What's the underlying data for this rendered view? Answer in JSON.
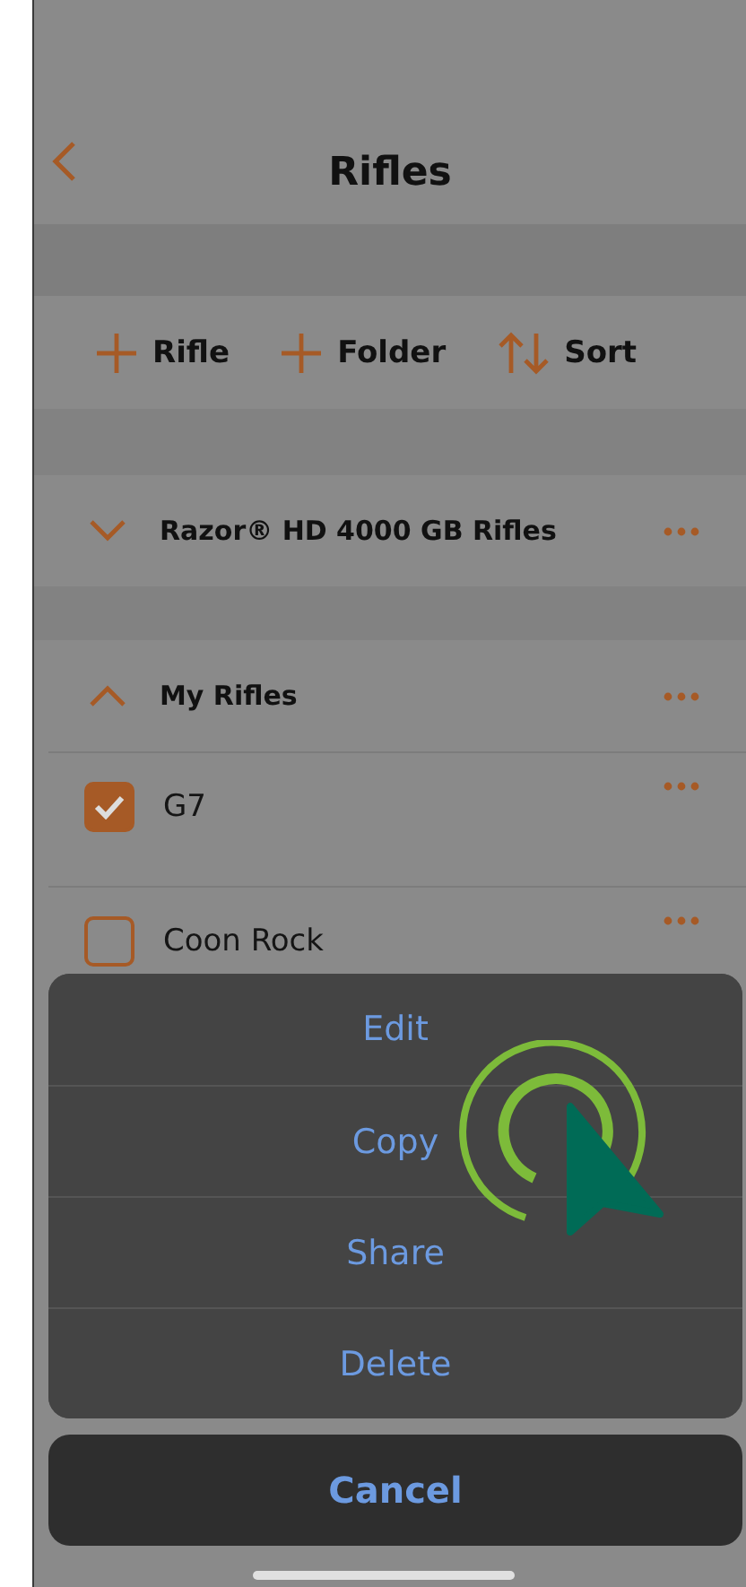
{
  "header": {
    "title": "Rifles"
  },
  "toolbar": [
    {
      "kind": "add",
      "label": "Rifle"
    },
    {
      "kind": "add",
      "label": "Folder"
    },
    {
      "kind": "sort",
      "label": "Sort"
    }
  ],
  "folders": [
    {
      "name": "Razor® HD 4000 GB Rifles",
      "expanded": false
    },
    {
      "name": "My Rifles",
      "expanded": true,
      "children": [
        {
          "name": "G7",
          "checked": true
        },
        {
          "name": "Coon Rock",
          "checked": false
        }
      ]
    }
  ],
  "action_sheet": {
    "actions": [
      "Edit",
      "Copy",
      "Share",
      "Delete"
    ],
    "cancel": "Cancel"
  }
}
